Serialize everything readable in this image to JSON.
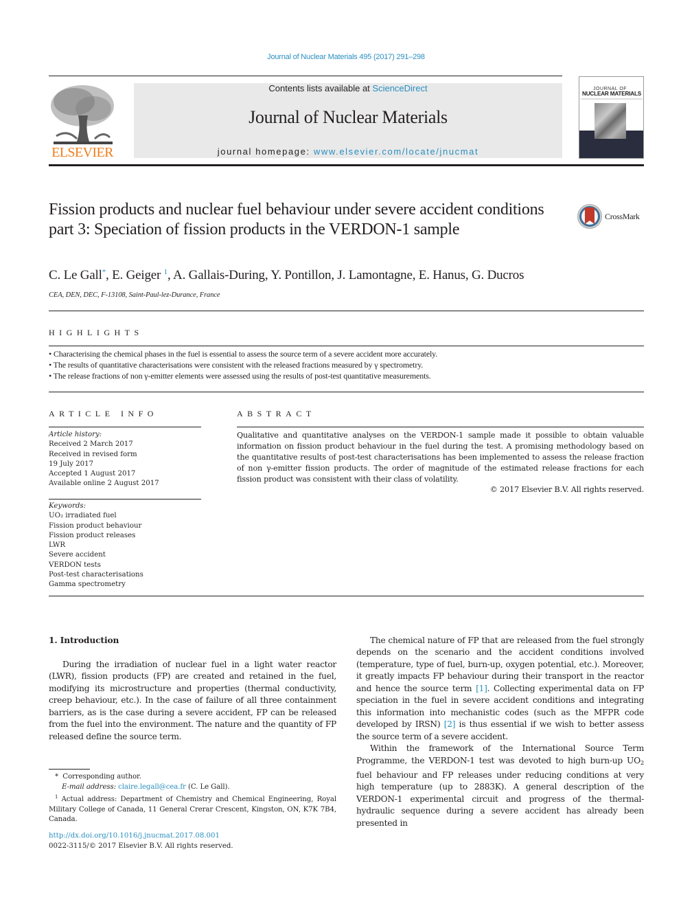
{
  "header": {
    "journal_reference": "Journal of Nuclear Materials 495 (2017) 291–298",
    "publisher_wordmark": "ELSEVIER",
    "contents_prefix": "Contents lists available at ",
    "contents_link": "ScienceDirect",
    "journal_title": "Journal of Nuclear Materials",
    "homepage_prefix": "journal homepage: ",
    "homepage_link": "www.elsevier.com/locate/jnucmat",
    "cover": {
      "title_line1": "JOURNAL OF",
      "title_line2": "NUCLEAR MATERIALS"
    },
    "publisher_color": "#f07d18",
    "link_color": "#2a8fc0"
  },
  "article": {
    "title": "Fission products and nuclear fuel behaviour under severe accident conditions part 3: Speciation of fission products in the VERDON-1 sample",
    "crossmark_label": "CrossMark",
    "authors": [
      {
        "name": "C. Le Gall",
        "mark": "*",
        "sep": ", "
      },
      {
        "name": "E. Geiger ",
        "mark": "1",
        "sep": ", "
      },
      {
        "name": "A. Gallais-During",
        "mark": "",
        "sep": ", "
      },
      {
        "name": "Y. Pontillon",
        "mark": "",
        "sep": ", "
      },
      {
        "name": "J. Lamontagne",
        "mark": "",
        "sep": ", "
      },
      {
        "name": "E. Hanus",
        "mark": "",
        "sep": ", "
      },
      {
        "name": "G. Ducros",
        "mark": "",
        "sep": ""
      }
    ],
    "affiliation": "CEA, DEN, DEC, F-13108, Saint-Paul-lez-Durance, France"
  },
  "highlights": {
    "label": "HIGHLIGHTS",
    "items": [
      "• Characterising the chemical phases in the fuel is essential to assess the source term of a severe accident more accurately.",
      "• The results of quantitative characterisations were consistent with the released fractions measured by γ spectrometry.",
      "• The release fractions of non γ-emitter elements were assessed using the results of post-test quantitative measurements."
    ]
  },
  "article_info": {
    "label": "ARTICLE INFO",
    "history_label": "Article history:",
    "history": [
      "Received 2 March 2017",
      "Received in revised form",
      "19 July 2017",
      "Accepted 1 August 2017",
      "Available online 2 August 2017"
    ],
    "keywords_label": "Keywords:",
    "keywords": [
      "UO₂ irradiated fuel",
      "Fission product behaviour",
      "Fission product releases",
      "LWR",
      "Severe accident",
      "VERDON tests",
      "Post-test characterisations",
      "Gamma spectrometry"
    ]
  },
  "abstract": {
    "label": "ABSTRACT",
    "text": "Qualitative and quantitative analyses on the VERDON-1 sample made it possible to obtain valuable information on fission product behaviour in the fuel during the test. A promising methodology based on the quantitative results of post-test characterisations has been implemented to assess the release fraction of non γ-emitter fission products. The order of magnitude of the estimated release fractions for each fission product was consistent with their class of volatility.",
    "copyright": "© 2017 Elsevier B.V. All rights reserved."
  },
  "body": {
    "section_heading": "1.  Introduction",
    "left_paragraph": "During the irradiation of nuclear fuel in a light water reactor (LWR), fission products (FP) are created and retained in the fuel, modifying its microstructure and properties (thermal conductivity, creep behaviour, etc.). In the case of failure of all three containment barriers, as is the case during a severe accident, FP can be released from the fuel into the environment. The nature and the quantity of FP released define the source term.",
    "right_p1_a": "The chemical nature of FP that are released from the fuel strongly depends on the scenario and the accident conditions involved (temperature, type of fuel, burn-up, oxygen potential, etc.). Moreover, it greatly impacts FP behaviour during their transport in the reactor and hence the source term ",
    "ref1": "[1]",
    "right_p1_b": ". Collecting experimental data on FP speciation in the fuel in severe accident conditions and integrating this information into mechanistic codes (such as the MFPR code developed by IRSN) ",
    "ref2": "[2]",
    "right_p1_c": " is thus essential if we wish to better assess the source term of a severe accident.",
    "right_p2_a": "Within the framework of the International Source Term Programme, the VERDON-1 test was devoted to high burn-up UO",
    "right_p2_sub": "2",
    "right_p2_b": " fuel behaviour and FP releases under reducing conditions at very high temperature (up to 2883K). A general description of the VERDON-1 experimental circuit and progress of the thermal-hydraulic sequence during a severe accident has already been presented in"
  },
  "footnotes": {
    "corresponding_mark": "*",
    "corresponding": "Corresponding author.",
    "email_label": "E-mail address: ",
    "email": "claire.legall@cea.fr",
    "email_suffix": " (C. Le Gall).",
    "fn1_mark": "1",
    "fn1_text": " Actual address: Department of Chemistry and Chemical Engineering, Royal Military College of Canada, 11 General Crerar Crescent, Kingston, ON, K7K 7B4, Canada.",
    "doi": "http://dx.doi.org/10.1016/j.jnucmat.2017.08.001",
    "issn": "0022-3115/© 2017 Elsevier B.V. All rights reserved."
  }
}
